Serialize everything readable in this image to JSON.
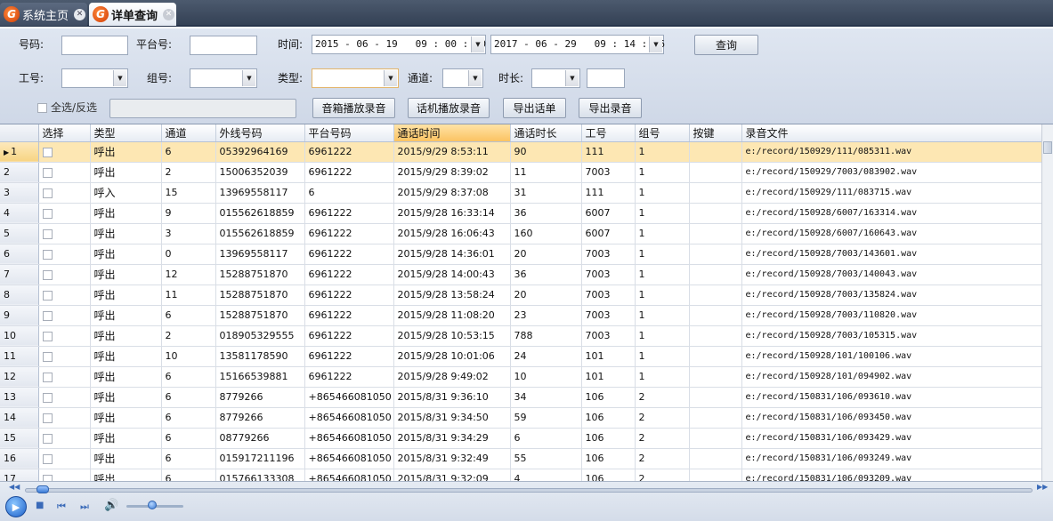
{
  "tabs": [
    {
      "label": "系统主页",
      "active": false
    },
    {
      "label": "详单查询",
      "active": true
    }
  ],
  "filters": {
    "number_label": "号码:",
    "platform_label": "平台号:",
    "time_label": "时间:",
    "start_time": "2015 - 06 - 19   09 : 00 : 00",
    "end_time": "2017 - 06 - 29   09 : 14 : 46",
    "query_button": "查询",
    "job_label": "工号:",
    "group_label": "组号:",
    "type_label": "类型:",
    "channel_label": "通道:",
    "duration_label": "时长:",
    "select_all_label": "全选/反选",
    "speaker_play_button": "音箱播放录音",
    "phone_play_button": "话机播放录音",
    "export_calls_button": "导出话单",
    "export_recordings_button": "导出录音"
  },
  "table": {
    "columns": [
      "选择",
      "类型",
      "通道",
      "外线号码",
      "平台号码",
      "通话时间",
      "通话时长",
      "工号",
      "组号",
      "按键",
      "录音文件"
    ],
    "sorted_column": "通话时间",
    "selected_row": 1,
    "rows": [
      [
        "1",
        "呼出",
        "6",
        "05392964169",
        "6961222",
        "2015/9/29 8:53:11",
        "90",
        "111",
        "1",
        "",
        "e:/record/150929/111/085311.wav"
      ],
      [
        "2",
        "呼出",
        "2",
        "15006352039",
        "6961222",
        "2015/9/29 8:39:02",
        "11",
        "7003",
        "1",
        "",
        "e:/record/150929/7003/083902.wav"
      ],
      [
        "3",
        "呼入",
        "15",
        "13969558117",
        "6",
        "2015/9/29 8:37:08",
        "31",
        "111",
        "1",
        "",
        "e:/record/150929/111/083715.wav"
      ],
      [
        "4",
        "呼出",
        "9",
        "015562618859",
        "6961222",
        "2015/9/28 16:33:14",
        "36",
        "6007",
        "1",
        "",
        "e:/record/150928/6007/163314.wav"
      ],
      [
        "5",
        "呼出",
        "3",
        "015562618859",
        "6961222",
        "2015/9/28 16:06:43",
        "160",
        "6007",
        "1",
        "",
        "e:/record/150928/6007/160643.wav"
      ],
      [
        "6",
        "呼出",
        "0",
        "13969558117",
        "6961222",
        "2015/9/28 14:36:01",
        "20",
        "7003",
        "1",
        "",
        "e:/record/150928/7003/143601.wav"
      ],
      [
        "7",
        "呼出",
        "12",
        "15288751870",
        "6961222",
        "2015/9/28 14:00:43",
        "36",
        "7003",
        "1",
        "",
        "e:/record/150928/7003/140043.wav"
      ],
      [
        "8",
        "呼出",
        "11",
        "15288751870",
        "6961222",
        "2015/9/28 13:58:24",
        "20",
        "7003",
        "1",
        "",
        "e:/record/150928/7003/135824.wav"
      ],
      [
        "9",
        "呼出",
        "6",
        "15288751870",
        "6961222",
        "2015/9/28 11:08:20",
        "23",
        "7003",
        "1",
        "",
        "e:/record/150928/7003/110820.wav"
      ],
      [
        "10",
        "呼出",
        "2",
        "018905329555",
        "6961222",
        "2015/9/28 10:53:15",
        "788",
        "7003",
        "1",
        "",
        "e:/record/150928/7003/105315.wav"
      ],
      [
        "11",
        "呼出",
        "10",
        "13581178590",
        "6961222",
        "2015/9/28 10:01:06",
        "24",
        "101",
        "1",
        "",
        "e:/record/150928/101/100106.wav"
      ],
      [
        "12",
        "呼出",
        "6",
        "15166539881",
        "6961222",
        "2015/9/28 9:49:02",
        "10",
        "101",
        "1",
        "",
        "e:/record/150928/101/094902.wav"
      ],
      [
        "13",
        "呼出",
        "6",
        "8779266",
        "+865466081050",
        "2015/8/31 9:36:10",
        "34",
        "106",
        "2",
        "",
        "e:/record/150831/106/093610.wav"
      ],
      [
        "14",
        "呼出",
        "6",
        "8779266",
        "+865466081050",
        "2015/8/31 9:34:50",
        "59",
        "106",
        "2",
        "",
        "e:/record/150831/106/093450.wav"
      ],
      [
        "15",
        "呼出",
        "6",
        "08779266",
        "+865466081050",
        "2015/8/31 9:34:29",
        "6",
        "106",
        "2",
        "",
        "e:/record/150831/106/093429.wav"
      ],
      [
        "16",
        "呼出",
        "6",
        "015917211196",
        "+865466081050",
        "2015/8/31 9:32:49",
        "55",
        "106",
        "2",
        "",
        "e:/record/150831/106/093249.wav"
      ],
      [
        "17",
        "呼出",
        "6",
        "015766133308",
        "+865466081050",
        "2015/8/31 9:32:09",
        "4",
        "106",
        "2",
        "",
        "e:/record/150831/106/093209.wav"
      ]
    ]
  },
  "player": {
    "play_icon": "play-icon",
    "stop_icon": "stop-icon",
    "prev_icon": "previous-icon",
    "next_icon": "next-icon",
    "volume_icon": "speaker-icon",
    "progress_fraction": 0.01,
    "volume_fraction": 0.45
  },
  "colors": {
    "tabbar": "#3f4c62",
    "selected_row": "#fde7b3",
    "sorted_header": "#fbc362",
    "logo": "#e0520f"
  }
}
